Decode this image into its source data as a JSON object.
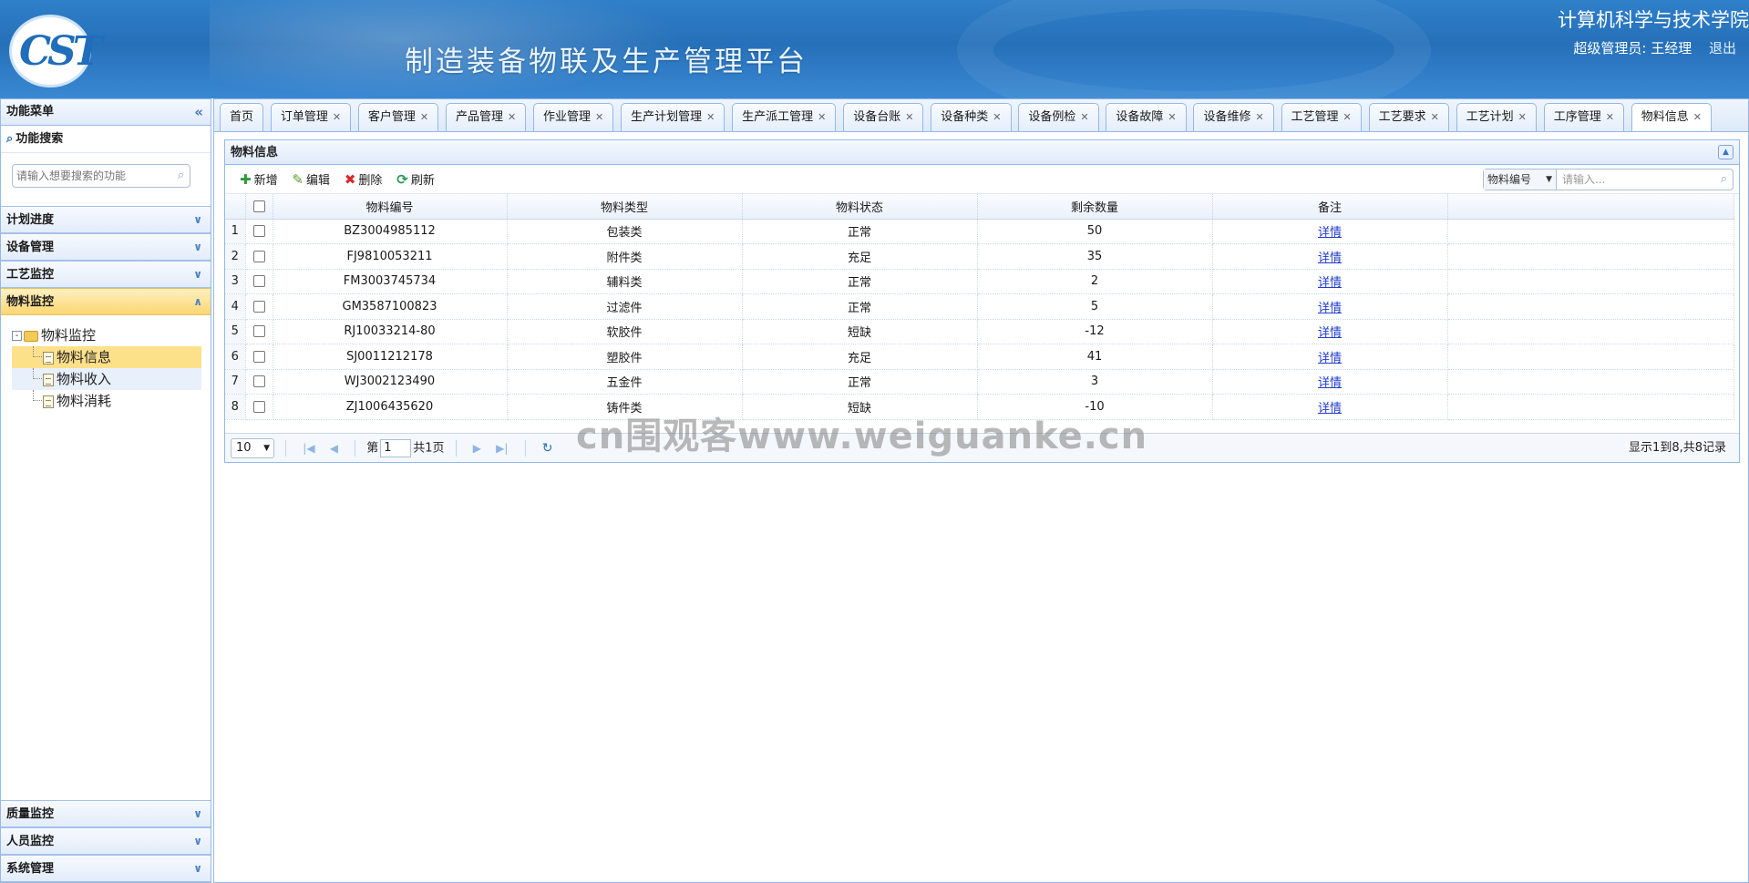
{
  "header": {
    "platform_title": "制造装备物联及生产管理平台",
    "college": "计算机科学与技术学院",
    "user": "超级管理员: 王经理",
    "logout": "退出",
    "logo_text": "CST"
  },
  "sidebar": {
    "title": "功能菜单",
    "collapse_icon": "«",
    "search_title": "功能搜索",
    "search_placeholder": "请输入想要搜索的功能",
    "groups_top": [
      "计划进度",
      "设备管理",
      "工艺监控"
    ],
    "selected_group": "物料监控",
    "tree": {
      "root": "物料监控",
      "children": [
        "物料信息",
        "物料收入",
        "物料消耗"
      ]
    },
    "groups_bottom": [
      "质量监控",
      "人员监控",
      "系统管理"
    ]
  },
  "tabs": [
    "首页",
    "订单管理",
    "客户管理",
    "产品管理",
    "作业管理",
    "生产计划管理",
    "生产派工管理",
    "设备台账",
    "设备种类",
    "设备例检",
    "设备故障",
    "设备维修",
    "工艺管理",
    "工艺要求",
    "工艺计划",
    "工序管理",
    "物料信息"
  ],
  "active_tab": "物料信息",
  "panel": {
    "title": "物料信息",
    "toolbar": {
      "add": "新增",
      "edit": "编辑",
      "delete": "删除",
      "refresh": "刷新"
    },
    "search": {
      "field": "物料编号",
      "placeholder": "请输入..."
    },
    "columns": [
      "物料编号",
      "物料类型",
      "物料状态",
      "剩余数量",
      "备注"
    ],
    "rows": [
      {
        "no": "1",
        "code": "BZ3004985112",
        "type": "包装类",
        "status": "正常",
        "qty": "50",
        "remark": "详情"
      },
      {
        "no": "2",
        "code": "FJ9810053211",
        "type": "附件类",
        "status": "充足",
        "qty": "35",
        "remark": "详情"
      },
      {
        "no": "3",
        "code": "FM3003745734",
        "type": "辅料类",
        "status": "正常",
        "qty": "2",
        "remark": "详情"
      },
      {
        "no": "4",
        "code": "GM3587100823",
        "type": "过滤件",
        "status": "正常",
        "qty": "5",
        "remark": "详情"
      },
      {
        "no": "5",
        "code": "RJ10033214-80",
        "type": "软胶件",
        "status": "短缺",
        "qty": "-12",
        "remark": "详情"
      },
      {
        "no": "6",
        "code": "SJ0011212178",
        "type": "塑胶件",
        "status": "充足",
        "qty": "41",
        "remark": "详情"
      },
      {
        "no": "7",
        "code": "WJ3002123490",
        "type": "五金件",
        "status": "正常",
        "qty": "3",
        "remark": "详情"
      },
      {
        "no": "8",
        "code": "ZJ1006435620",
        "type": "铸件类",
        "status": "短缺",
        "qty": "-10",
        "remark": "详情"
      }
    ],
    "pager": {
      "page_size": "10",
      "page_prefix": "第",
      "page": "1",
      "page_suffix": "共1页",
      "info": "显示1到8,共8记录"
    }
  },
  "watermark": "cn围观客www.weiguanke.cn"
}
